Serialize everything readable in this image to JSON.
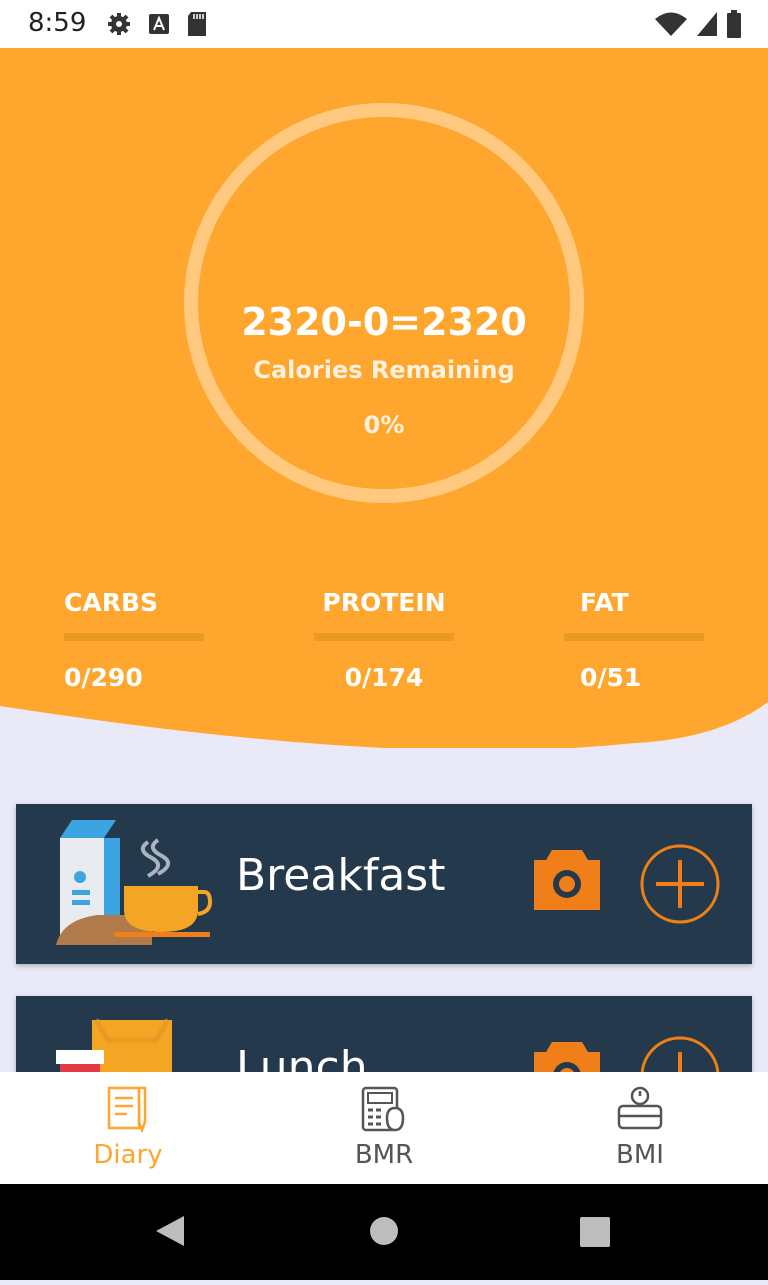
{
  "status_bar": {
    "time": "8:59"
  },
  "summary": {
    "equation": "2320-0=2320",
    "label": "Calories Remaining",
    "percent": "0%",
    "progress_fraction": 0
  },
  "macros": [
    {
      "label": "CARBS",
      "value": "0/290"
    },
    {
      "label": "PROTEIN",
      "value": "0/174"
    },
    {
      "label": "FAT",
      "value": "0/51"
    }
  ],
  "meals": [
    {
      "name": "Breakfast"
    },
    {
      "name": "Lunch"
    }
  ],
  "bottom_nav": {
    "items": [
      {
        "label": "Diary",
        "icon": "diary-icon",
        "active": true
      },
      {
        "label": "BMR",
        "icon": "calculator-kcal-icon",
        "active": false
      },
      {
        "label": "BMI",
        "icon": "scale-icon",
        "active": false
      }
    ]
  },
  "colors": {
    "accent": "#ffa62e",
    "card": "#25394c",
    "action": "#f07f1a",
    "background": "#e9e9f8"
  }
}
